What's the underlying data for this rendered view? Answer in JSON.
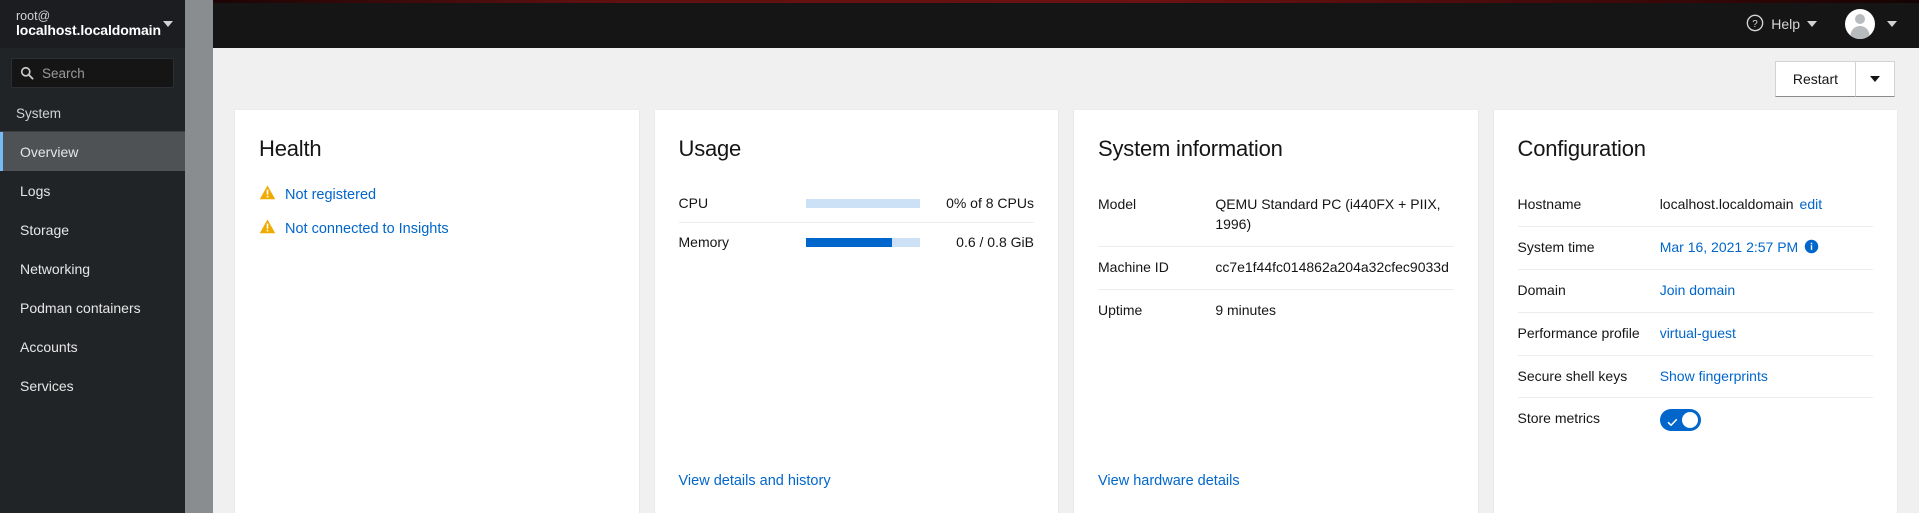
{
  "sidebar": {
    "host": {
      "user": "root@",
      "hostname": "localhost.localdomain",
      "caret_icon": "chevron-down-icon"
    },
    "search": {
      "placeholder": "Search",
      "value": "",
      "icon": "search-icon"
    },
    "group_title": "System",
    "items": [
      {
        "label": "Overview",
        "active": true
      },
      {
        "label": "Logs",
        "active": false
      },
      {
        "label": "Storage",
        "active": false
      },
      {
        "label": "Networking",
        "active": false
      },
      {
        "label": "Podman containers",
        "active": false
      },
      {
        "label": "Accounts",
        "active": false
      },
      {
        "label": "Services",
        "active": false
      }
    ]
  },
  "topbar": {
    "help_label": "Help",
    "help_icon": "question-circle-icon",
    "help_caret_icon": "chevron-down-icon",
    "avatar_icon": "user-avatar-icon",
    "avatar_caret_icon": "chevron-down-icon"
  },
  "actionbar": {
    "restart_label": "Restart",
    "restart_caret_icon": "chevron-down-icon"
  },
  "cards": {
    "health": {
      "title": "Health",
      "items": [
        {
          "icon": "warning-triangle-icon",
          "label": "Not registered"
        },
        {
          "icon": "warning-triangle-icon",
          "label": "Not connected to Insights"
        }
      ]
    },
    "usage": {
      "title": "Usage",
      "rows": [
        {
          "label": "CPU",
          "value": "0% of 8 CPUs",
          "percent": 0
        },
        {
          "label": "Memory",
          "value": "0.6 / 0.8 GiB",
          "percent": 75
        }
      ],
      "footer_link": "View details and history"
    },
    "system_information": {
      "title": "System information",
      "rows": [
        {
          "key": "Model",
          "value": "QEMU Standard PC (i440FX + PIIX, 1996)"
        },
        {
          "key": "Machine ID",
          "value": "cc7e1f44fc014862a204a32cfec9033d"
        },
        {
          "key": "Uptime",
          "value": "9 minutes"
        }
      ],
      "footer_link": "View hardware details"
    },
    "configuration": {
      "title": "Configuration",
      "hostname_key": "Hostname",
      "hostname_value": "localhost.localdomain",
      "hostname_edit": "edit",
      "system_time_key": "System time",
      "system_time_value": "Mar 16, 2021 2:57 PM",
      "system_time_icon": "info-circle-icon",
      "domain_key": "Domain",
      "domain_value": "Join domain",
      "perf_key": "Performance profile",
      "perf_value": "virtual-guest",
      "ssh_key": "Secure shell keys",
      "ssh_value": "Show fingerprints",
      "metrics_key": "Store metrics",
      "metrics_toggle_on": true,
      "metrics_toggle_icon": "check-icon"
    }
  },
  "colors": {
    "accent_blue": "#06c",
    "warning_orange": "#f0ab00",
    "sidebar_bg": "#212427",
    "active_item_bg": "#4f5255",
    "active_marker": "#73bcf7"
  }
}
